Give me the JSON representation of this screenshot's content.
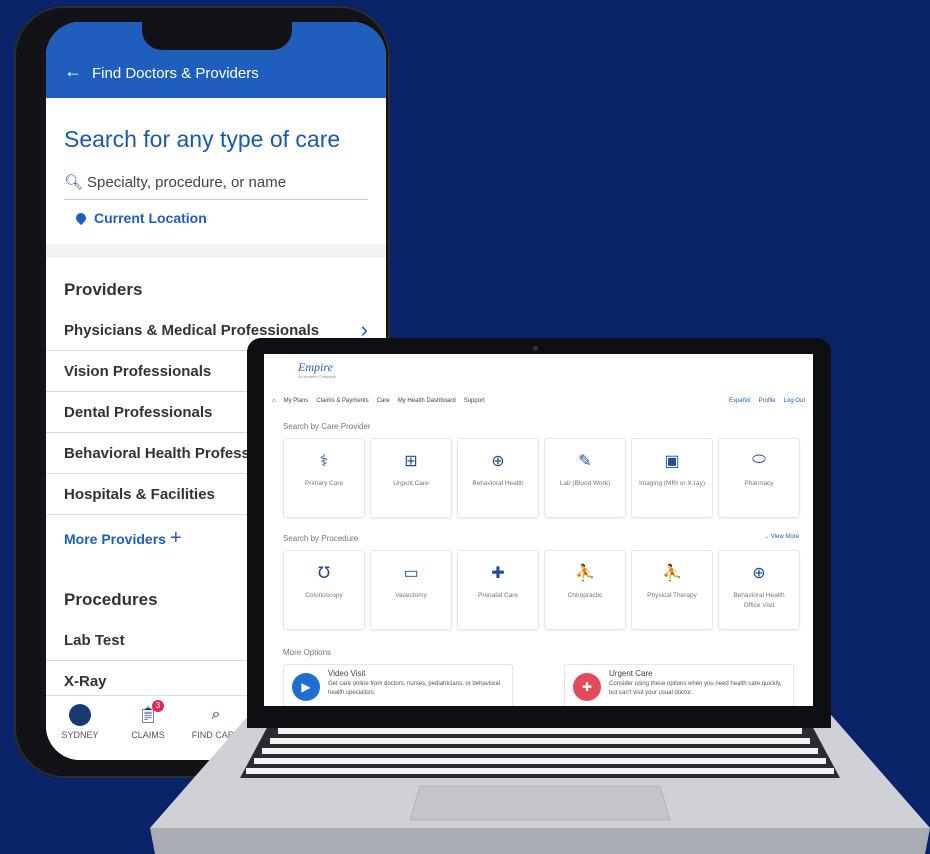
{
  "phone": {
    "header_title": "Find Doctors & Providers",
    "back_icon": "arrow-left-icon",
    "search_title": "Search for any type of care",
    "search_placeholder": "Specialty, procedure, or name",
    "location_label": "Current Location",
    "providers_heading": "Providers",
    "providers": [
      "Physicians & Medical Professionals",
      "Vision Professionals",
      "Dental Professionals",
      "Behavioral Health Professio",
      "Hospitals & Facilities"
    ],
    "more_providers": "More Providers",
    "procedures_heading": "Procedures",
    "procedures": [
      "Lab Test",
      "X-Ray"
    ],
    "tabs": [
      {
        "label": "SYDNEY",
        "icon": "avatar-icon"
      },
      {
        "label": "CLAIMS",
        "icon": "claims-icon",
        "badge": "3"
      },
      {
        "label": "FIND CARE",
        "icon": "search-icon"
      }
    ]
  },
  "laptop": {
    "logo": "Empire",
    "logo_sub": "An Anthem Company",
    "nav": [
      "My Plans",
      "Claims & Payments",
      "Care",
      "My Health Dashboard",
      "Support"
    ],
    "nav_right": [
      "Español",
      "Profile",
      "Log Out"
    ],
    "care_provider_label": "Search by Care Provider",
    "care_providers": [
      {
        "label": "Primary Care",
        "icon": "doctor-icon"
      },
      {
        "label": "Urgent Care",
        "icon": "first-aid-icon"
      },
      {
        "label": "Behavioral Health",
        "icon": "brain-icon"
      },
      {
        "label": "Lab (Blood Work)",
        "icon": "pen-icon"
      },
      {
        "label": "Imaging (MRI or X-ray)",
        "icon": "xray-icon"
      },
      {
        "label": "Pharmacy",
        "icon": "pill-icon"
      }
    ],
    "procedure_label": "Search by Procedure",
    "view_more": "View More",
    "procedures": [
      {
        "label": "Colonoscopy",
        "icon": "colon-icon"
      },
      {
        "label": "Vasectomy",
        "icon": "clipboard-icon"
      },
      {
        "label": "Prenatal Care",
        "icon": "cross-icon"
      },
      {
        "label": "Chiropractic",
        "icon": "therapy-icon"
      },
      {
        "label": "Physical Therapy",
        "icon": "therapy-icon"
      },
      {
        "label": "Behavioral Health Office Visit",
        "icon": "brain-icon"
      }
    ],
    "more_options_label": "More Options",
    "options": [
      {
        "title": "Video Visit",
        "desc": "Get care online from doctors, nurses, pediatricians, or behavioral health specialists.",
        "color": "#1f6fd1"
      },
      {
        "title": "Urgent Care",
        "desc": "Consider using these options when you need health care quickly, but can't visit your usual doctor.",
        "color": "#e14b5a"
      }
    ]
  },
  "colors": {
    "background": "#0a2267",
    "brand": "#1f5ebd"
  }
}
